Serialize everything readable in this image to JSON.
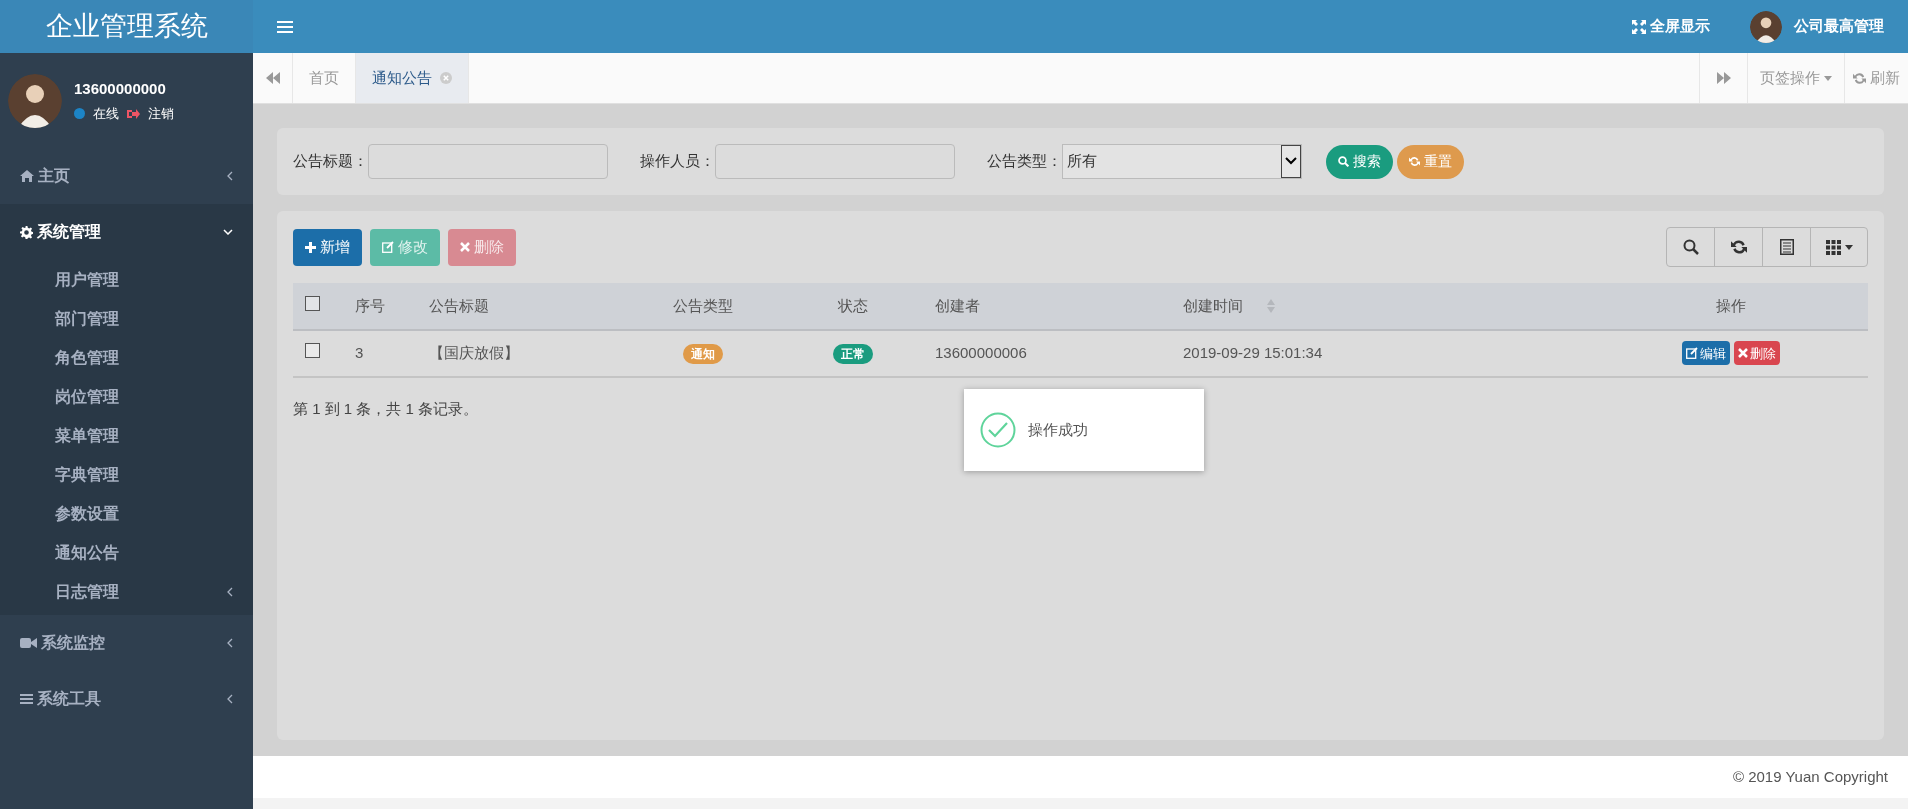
{
  "brand": "企业管理系统",
  "user": {
    "name": "13600000000",
    "status": "在线",
    "logout": "注销"
  },
  "sidebar": {
    "items": [
      {
        "label": "主页",
        "expanded": false
      },
      {
        "label": "系统管理",
        "expanded": true,
        "children": [
          {
            "label": "用户管理"
          },
          {
            "label": "部门管理"
          },
          {
            "label": "角色管理"
          },
          {
            "label": "岗位管理"
          },
          {
            "label": "菜单管理"
          },
          {
            "label": "字典管理"
          },
          {
            "label": "参数设置"
          },
          {
            "label": "通知公告"
          },
          {
            "label": "日志管理",
            "has_children": true
          }
        ]
      },
      {
        "label": "系统监控",
        "expanded": false
      },
      {
        "label": "系统工具",
        "expanded": false
      }
    ]
  },
  "topbar": {
    "fullscreen": "全屏显示",
    "account": "公司最高管理"
  },
  "tabs": [
    {
      "label": "首页",
      "selected": false,
      "closable": false
    },
    {
      "label": "通知公告",
      "selected": true,
      "closable": true
    }
  ],
  "tab_actions": {
    "menu": "页签操作",
    "refresh": "刷新"
  },
  "search": {
    "fields": [
      {
        "label": "公告标题：",
        "kind": "text"
      },
      {
        "label": "操作人员：",
        "kind": "text"
      },
      {
        "label": "公告类型：",
        "kind": "select",
        "value": "所有"
      }
    ],
    "buttons": [
      {
        "label": "搜索",
        "kind": "search"
      },
      {
        "label": "重置",
        "kind": "reset"
      }
    ]
  },
  "toolbar": [
    {
      "label": "新增",
      "kind": "add",
      "disabled": false
    },
    {
      "label": "修改",
      "kind": "edit",
      "disabled": true
    },
    {
      "label": "删除",
      "kind": "delete",
      "disabled": true
    }
  ],
  "table": {
    "all_checked": false,
    "columns": [
      {
        "label": "序号"
      },
      {
        "label": "公告标题"
      },
      {
        "label": "公告类型"
      },
      {
        "label": "状态"
      },
      {
        "label": "创建者"
      },
      {
        "label": "创建时间",
        "sortable": true
      },
      {
        "label": "操作"
      }
    ],
    "rows": [
      {
        "checked": false,
        "id": "3",
        "title": "【国庆放假】",
        "type": "通知",
        "status": "正常",
        "creator": "13600000006",
        "created": "2019-09-29 15:01:34",
        "actions": [
          {
            "label": "编辑",
            "kind": "edit"
          },
          {
            "label": "删除",
            "kind": "delete"
          }
        ]
      }
    ]
  },
  "pagination": "第 1 到 1 条，共 1 条记录。",
  "toast": {
    "message": "操作成功"
  },
  "footer": "© 2019 Yuan Copyright"
}
